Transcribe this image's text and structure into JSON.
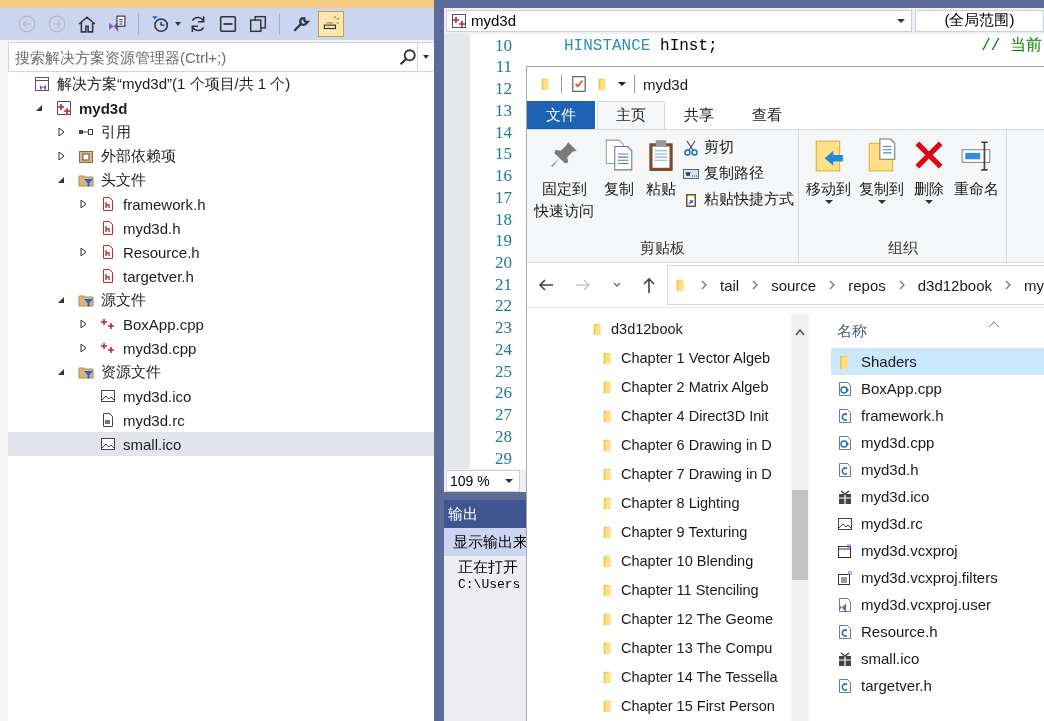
{
  "solution_explorer": {
    "toolbar": [
      {
        "kind": "back",
        "disabled": true,
        "selected": false
      },
      {
        "kind": "forward",
        "disabled": true,
        "selected": false
      },
      {
        "kind": "home",
        "disabled": false,
        "selected": false
      },
      {
        "kind": "switch-view",
        "disabled": false,
        "selected": false
      },
      {
        "kind": "history",
        "disabled": false,
        "selected": false
      },
      {
        "kind": "refresh",
        "disabled": false,
        "selected": false
      },
      {
        "kind": "collapse",
        "disabled": false,
        "selected": false
      },
      {
        "kind": "windows",
        "disabled": false,
        "selected": false
      },
      {
        "kind": "properties",
        "disabled": false,
        "selected": false
      },
      {
        "kind": "preview",
        "disabled": false,
        "selected": true
      }
    ],
    "search": {
      "placeholder": "搜索解决方案资源管理器(Ctrl+;)"
    },
    "tree": [
      {
        "label": "解决方案“myd3d”(1 个项目/共 1 个)",
        "kind": "solution",
        "selected": false,
        "children": [
          {
            "label": "myd3d",
            "kind": "project",
            "expanded": true,
            "selected": false,
            "children": [
              {
                "label": "引用",
                "kind": "reference",
                "expanded": false,
                "selected": false
              },
              {
                "label": "外部依赖项",
                "kind": "external",
                "expanded": false,
                "selected": false
              },
              {
                "label": "头文件",
                "kind": "filter",
                "expanded": true,
                "selected": false,
                "children": [
                  {
                    "label": "framework.h",
                    "kind": "header",
                    "expanded": false,
                    "selected": false
                  },
                  {
                    "label": "myd3d.h",
                    "kind": "header",
                    "selected": false
                  },
                  {
                    "label": "Resource.h",
                    "kind": "header",
                    "expanded": false,
                    "selected": false
                  },
                  {
                    "label": "targetver.h",
                    "kind": "header",
                    "selected": false
                  }
                ]
              },
              {
                "label": "源文件",
                "kind": "filter",
                "expanded": true,
                "selected": false,
                "children": [
                  {
                    "label": "BoxApp.cpp",
                    "kind": "cpp",
                    "expanded": false,
                    "selected": false
                  },
                  {
                    "label": "myd3d.cpp",
                    "kind": "cpp",
                    "expanded": false,
                    "selected": false
                  }
                ]
              },
              {
                "label": "资源文件",
                "kind": "filter",
                "expanded": true,
                "selected": false,
                "children": [
                  {
                    "label": "myd3d.ico",
                    "kind": "image",
                    "selected": false
                  },
                  {
                    "label": "myd3d.rc",
                    "kind": "resource",
                    "selected": false
                  },
                  {
                    "label": "small.ico",
                    "kind": "image",
                    "selected": true
                  }
                ]
              }
            ]
          }
        ]
      }
    ]
  },
  "editor": {
    "project_dropdown": "myd3d",
    "scope_dropdown": "(全局范围)",
    "lines": [
      {
        "number": "10",
        "tokens": [
          {
            "text": "HINSTANCE",
            "kind": "type"
          },
          {
            "text": " hInst;",
            "kind": "plain"
          }
        ],
        "comment": "// 当前"
      },
      {
        "number": "11"
      },
      {
        "number": "12"
      },
      {
        "number": "13"
      },
      {
        "number": "14"
      },
      {
        "number": "15"
      },
      {
        "number": "16"
      },
      {
        "number": "17"
      },
      {
        "number": "18"
      },
      {
        "number": "19"
      },
      {
        "number": "20"
      },
      {
        "number": "21"
      },
      {
        "number": "22"
      },
      {
        "number": "23"
      },
      {
        "number": "24"
      },
      {
        "number": "25"
      },
      {
        "number": "26"
      },
      {
        "number": "27"
      },
      {
        "number": "28"
      },
      {
        "number": "29"
      }
    ],
    "zoom": "109 %"
  },
  "output": {
    "title": "输出",
    "source_label": "显示输出来",
    "lines": [
      {
        "text": "正在打开",
        "kind": "message"
      },
      {
        "text": "C:\\Users",
        "kind": "console"
      }
    ]
  },
  "file_explorer": {
    "title": "myd3d",
    "ribbon": {
      "tabs": [
        {
          "label": "文件",
          "kind": "file",
          "selected": false
        },
        {
          "label": "主页",
          "kind": "tab",
          "selected": true
        },
        {
          "label": "共享",
          "kind": "tab",
          "selected": false
        },
        {
          "label": "查看",
          "kind": "tab",
          "selected": false
        }
      ],
      "groups": [
        {
          "label": "剪贴板",
          "large_buttons": [
            {
              "label": "固定到",
              "label_2": "快速访问",
              "kind": "pin",
              "dropdown": false
            },
            {
              "label": "复制",
              "kind": "copy",
              "dropdown": false
            },
            {
              "label": "粘贴",
              "kind": "paste",
              "dropdown": false
            }
          ],
          "small_buttons": [
            {
              "label": "剪切",
              "kind": "cut"
            },
            {
              "label": "复制路径",
              "kind": "copy-path"
            },
            {
              "label": "粘贴快捷方式",
              "kind": "paste-shortcut"
            }
          ]
        },
        {
          "label": "组织",
          "large_buttons": [
            {
              "label": "移动到",
              "kind": "move-to",
              "dropdown": true
            },
            {
              "label": "复制到",
              "kind": "copy-to",
              "dropdown": true
            },
            {
              "label": "删除",
              "kind": "delete",
              "dropdown": true
            },
            {
              "label": "重命名",
              "kind": "rename",
              "dropdown": false
            }
          ]
        }
      ]
    },
    "address": {
      "segments": [
        "tail",
        "source",
        "repos",
        "d3d12book",
        "my"
      ]
    },
    "nav": [
      {
        "label": "d3d12book",
        "children": [
          {
            "label": "Chapter 1 Vector Algeb"
          },
          {
            "label": "Chapter 2 Matrix Algeb"
          },
          {
            "label": "Chapter 4 Direct3D Init"
          },
          {
            "label": "Chapter 6 Drawing in D"
          },
          {
            "label": "Chapter 7 Drawing in D"
          },
          {
            "label": "Chapter 8 Lighting"
          },
          {
            "label": "Chapter 9 Texturing"
          },
          {
            "label": "Chapter 10 Blending"
          },
          {
            "label": "Chapter 11 Stenciling"
          },
          {
            "label": "Chapter 12 The Geome"
          },
          {
            "label": "Chapter 13 The Compu"
          },
          {
            "label": "Chapter 14 The Tessella"
          },
          {
            "label": "Chapter 15 First Person"
          }
        ]
      }
    ],
    "files": {
      "column": "名称",
      "items": [
        {
          "name": "Shaders",
          "kind": "folder",
          "selected": true
        },
        {
          "name": "BoxApp.cpp",
          "kind": "cpp",
          "selected": false
        },
        {
          "name": "framework.h",
          "kind": "c",
          "selected": false
        },
        {
          "name": "myd3d.cpp",
          "kind": "cpp",
          "selected": false
        },
        {
          "name": "myd3d.h",
          "kind": "c",
          "selected": false
        },
        {
          "name": "myd3d.ico",
          "kind": "gift",
          "selected": false
        },
        {
          "name": "myd3d.rc",
          "kind": "image",
          "selected": false
        },
        {
          "name": "myd3d.vcxproj",
          "kind": "project",
          "selected": false
        },
        {
          "name": "myd3d.vcxproj.filters",
          "kind": "filters",
          "selected": false
        },
        {
          "name": "myd3d.vcxproj.user",
          "kind": "user",
          "selected": false
        },
        {
          "name": "Resource.h",
          "kind": "c",
          "selected": false
        },
        {
          "name": "small.ico",
          "kind": "gift",
          "selected": false
        },
        {
          "name": "targetver.h",
          "kind": "c",
          "selected": false
        }
      ]
    }
  }
}
